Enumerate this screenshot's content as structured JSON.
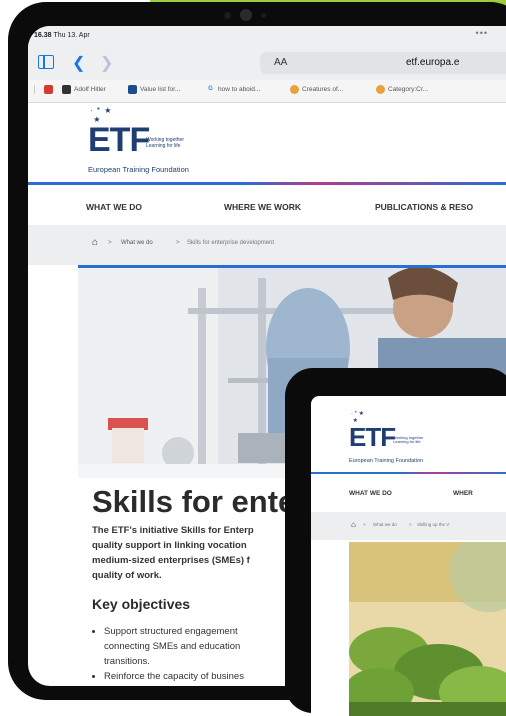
{
  "status": {
    "time": "16.38",
    "date": "Thu 13. Apr",
    "dots": "•••"
  },
  "browser": {
    "text_size_label": "AA",
    "url": "etf.europa.e",
    "bookmarks": [
      "Adolf Hitler",
      "Value list for...",
      "how to aboid...",
      "Creatures of...",
      "Category:Cr..."
    ],
    "bookmark_icons": [
      "G",
      "G"
    ]
  },
  "site": {
    "logo_letters": "ETF",
    "tagline_line1": "Working together",
    "tagline_line2": "Learning for life",
    "org_name": "European Training Foundation",
    "nav": [
      "WHAT WE DO",
      "WHERE WE WORK",
      "PUBLICATIONS & RESO"
    ],
    "breadcrumb": [
      "What we do",
      "Skills for enterprise development"
    ],
    "breadcrumb_sep": ">",
    "page_title": "Skills for ente",
    "intro_lines": [
      "The ETF's initiative Skills for Enterp",
      "quality support in linking vocation",
      "medium-sized enterprises (SMEs) f",
      "quality of work."
    ],
    "key_heading": "Key objectives",
    "objectives": [
      [
        "Support structured engagement",
        "connecting SMEs and education",
        "transitions."
      ],
      [
        "Reinforce the capacity of busines"
      ]
    ]
  },
  "second_device": {
    "logo_letters": "ETF",
    "tagline_line1": "Working together",
    "tagline_line2": "Learning for life",
    "org_name": "European Training Foundation",
    "nav": [
      "WHAT WE DO",
      "WHER"
    ],
    "breadcrumb": [
      "What we do",
      "Skilling up the V"
    ]
  },
  "colors": {
    "accent_green": "#9ccd3a",
    "etf_blue": "#1f3f73",
    "link_blue": "#2a6ed3",
    "magenta": "#b23c8d"
  }
}
